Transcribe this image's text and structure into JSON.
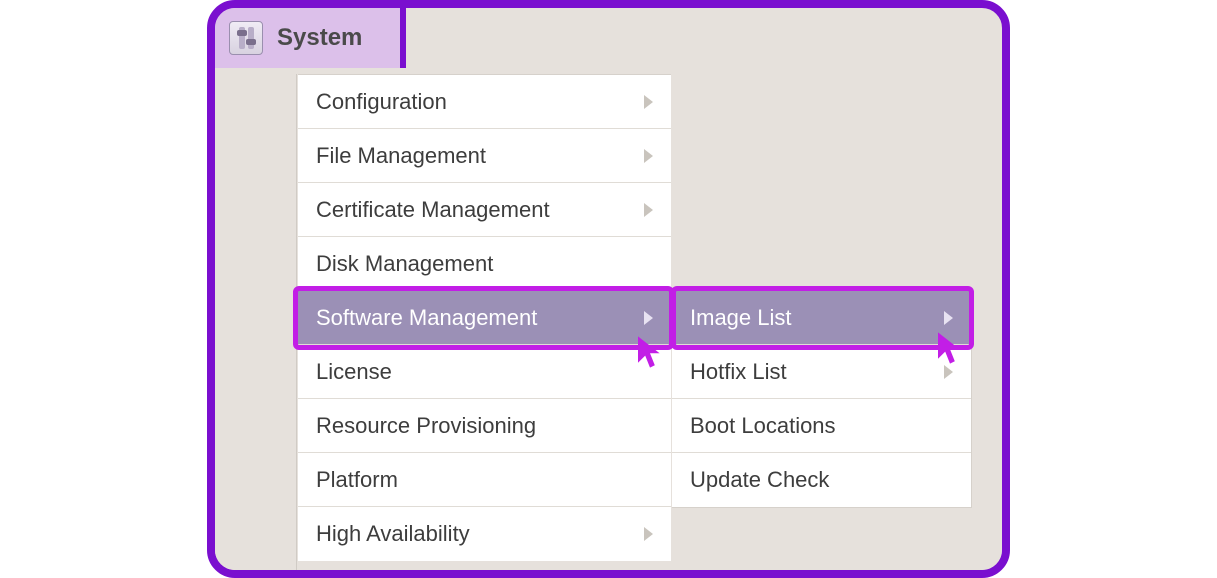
{
  "tab": {
    "label": "System"
  },
  "menu": {
    "items": [
      {
        "label": "Configuration",
        "has_sub": true,
        "selected": false
      },
      {
        "label": "File Management",
        "has_sub": true,
        "selected": false
      },
      {
        "label": "Certificate Management",
        "has_sub": true,
        "selected": false
      },
      {
        "label": "Disk Management",
        "has_sub": false,
        "selected": false
      },
      {
        "label": "Software Management",
        "has_sub": true,
        "selected": true
      },
      {
        "label": "License",
        "has_sub": false,
        "selected": false
      },
      {
        "label": "Resource Provisioning",
        "has_sub": false,
        "selected": false
      },
      {
        "label": "Platform",
        "has_sub": false,
        "selected": false
      },
      {
        "label": "High Availability",
        "has_sub": true,
        "selected": false
      }
    ]
  },
  "submenu": {
    "items": [
      {
        "label": "Image List",
        "has_sub": true,
        "selected": true
      },
      {
        "label": "Hotfix List",
        "has_sub": true,
        "selected": false
      },
      {
        "label": "Boot Locations",
        "has_sub": false,
        "selected": false
      },
      {
        "label": "Update Check",
        "has_sub": false,
        "selected": false
      }
    ]
  },
  "colors": {
    "frame_border": "#7a0fcf",
    "highlight": "#c21ee6",
    "tab_bg": "#dcc0ea",
    "selected_bg": "#9b90b6"
  }
}
